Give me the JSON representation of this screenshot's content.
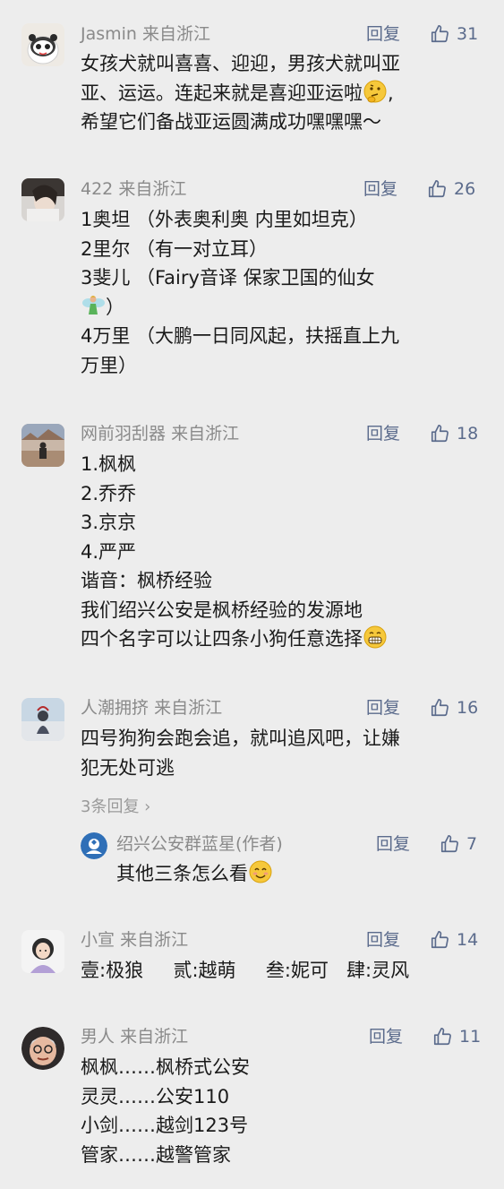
{
  "comments": [
    {
      "user": "Jasmin",
      "location": "来自浙江",
      "reply_label": "回复",
      "likes": "31",
      "lines": [
        "女孩犬就叫喜喜、迎迎，男孩犬就叫亚",
        "亚、运运。连起来就是喜迎亚运啦",
        "希望它们备战亚运圆满成功嘿嘿嘿～"
      ]
    },
    {
      "user": "422",
      "location": "来自浙江",
      "reply_label": "回复",
      "likes": "26",
      "lines": [
        "1奥坦 （外表奥利奥 内里如坦克）",
        "2里尔 （有一对立耳）",
        "3斐儿 （Fairy音译 保家卫国的仙女",
        "）",
        "4万里 （大鹏一日同风起，扶摇直上九",
        "万里）"
      ]
    },
    {
      "user": "网前羽刮器",
      "location": "来自浙江",
      "reply_label": "回复",
      "likes": "18",
      "lines": [
        "1.枫枫",
        "2.乔乔",
        "3.京京",
        "4.严严",
        "谐音：枫桥经验",
        "我们绍兴公安是枫桥经验的发源地",
        "四个名字可以让四条小狗任意选择"
      ]
    },
    {
      "user": "人潮拥挤",
      "location": "来自浙江",
      "reply_label": "回复",
      "likes": "16",
      "lines": [
        "四号狗狗会跑会追，就叫追风吧，让嫌",
        "犯无处可逃"
      ],
      "more_replies": "3条回复",
      "sub_reply": {
        "user": "绍兴公安群蓝星(作者)",
        "reply_label": "回复",
        "likes": "7",
        "text": "其他三条怎么看"
      }
    },
    {
      "user": "小宣",
      "location": "来自浙江",
      "reply_label": "回复",
      "likes": "14",
      "lines": [
        "壹:极狼     贰:越萌     叁:妮可   肆:灵风"
      ]
    },
    {
      "user": "男人",
      "location": "来自浙江",
      "reply_label": "回复",
      "likes": "11",
      "lines": [
        "枫枫……枫桥式公安",
        "灵灵……公安110",
        "小剑……越剑123号",
        "管家……越警管家"
      ]
    }
  ],
  "colors": {
    "background": "#ededed",
    "meta": "#8a8a8a",
    "action": "#5b6b8c",
    "text": "#1a1a1a"
  }
}
